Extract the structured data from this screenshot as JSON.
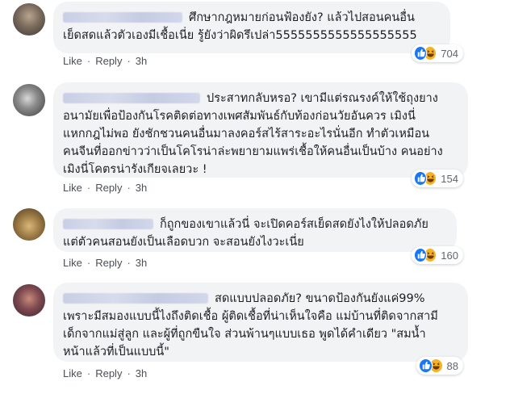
{
  "ui": {
    "like_label": "Like",
    "reply_label": "Reply",
    "separator": "·"
  },
  "comments": [
    {
      "text": "ศึกษากฎหมายก่อนฟ้องยัง? แล้วไปสอนคนอื่น\nเย็ดสดแล้วตัวเองมีเชื้อเนี่ย รู้ยังว่าผิดรึเปล่า5555555555555555555",
      "time": "3h",
      "reaction_count": "704",
      "reactions": [
        "like-icon",
        "haha-icon"
      ]
    },
    {
      "text": "ประสาทกลับหรอ? เขามีแต่รณรงค์ให้ใช้ถุงยาง\nอนามัยเพื่อป้องกันโรคติดต่อทางเพศสัมพันธ์กับท้องก่อนวัยอันควร เมิงนี่\nแหกกฎไม่พอ ยังชักชวนคนอื่นมาลงคอร์สไร้สาระอะไรนั่นอีก ทำตัวเหมือน\nคนจีนที่ออกข่าวว่าเป็นโคโรน่าล่ะพยายามแพร่เชื้อให้คนอื่นเป็นบ้าง คนอย่าง\nเมิงนี่โคตรน่ารังเกียจเลยวะ !",
      "time": "3h",
      "reaction_count": "154",
      "reactions": [
        "like-icon",
        "haha-icon"
      ]
    },
    {
      "text": "ก็ถูกของเขาแล้วนี่ จะเปิดคอร์สเย็ดสดยังไงให้ปลอดภัย\nแต่ตัวคนสอนยังเป็นเลือดบวก จะสอนยังไงวะเนี่ย",
      "time": "3h",
      "reaction_count": "160",
      "reactions": [
        "like-icon",
        "haha-icon"
      ]
    },
    {
      "text": "สดแบบปลอดภัย? ขนาดป้องกันยังแค่99%\nเพราะมีสมองแบบนี้ไงถึงติดเชื้อ ผู้ติดเชื้อที่น่าเห็นใจคือ แม่บ้านที่ติดจากสามี\nเด็กจากแม่สู่ลูก และผู้ที่ถูกขืนใจ ส่วนพ้านๆแบบเธอ พูดได้คำเดียว \"สมน้ำ\nหน้าแล้วที่เป็นแบบนี้\"",
      "time": "3h",
      "reaction_count": "88",
      "reactions": [
        "like-icon",
        "haha-icon"
      ]
    }
  ]
}
